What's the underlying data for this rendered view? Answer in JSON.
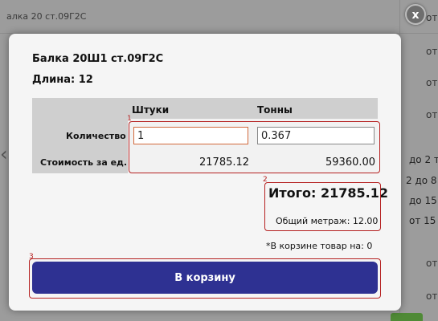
{
  "background": {
    "top_title": "алка 20 ст.09Г2С",
    "right_col_top": [
      "от",
      "от",
      "от",
      "от"
    ],
    "right_col_mid": [
      "до 2 т",
      "2 до 8 т",
      "до 15 т",
      "от 15 т"
    ],
    "right_col_bottom": [
      "от",
      "от"
    ]
  },
  "close_label": "x",
  "product": {
    "name": "Балка 20Ш1 ст.09Г2С",
    "length": "Длина: 12"
  },
  "table": {
    "col_pieces": "Штуки",
    "col_tons": "Тонны",
    "row_quantity": "Количество",
    "row_unit_price": "Стоимость за ед.",
    "qty_pieces_value": "1",
    "qty_tons_value": "0.367",
    "price_pieces": "21785.12",
    "price_tons": "59360.00"
  },
  "summary": {
    "total": "Итого: 21785.12",
    "meterage": "Общий метраж: 12.00"
  },
  "cart_note": "*В корзине товар на: 0",
  "add_to_cart_label": "В корзину",
  "annotations": [
    "1",
    "2",
    "3"
  ],
  "colors": {
    "button_bg": "#2e3192",
    "annotation": "#b52020",
    "focused_input_border": "#d2693c"
  }
}
